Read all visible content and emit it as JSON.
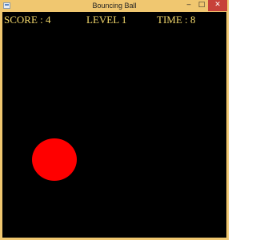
{
  "window": {
    "title": "Bouncing Ball",
    "controls": {
      "minimize": "‒",
      "maximize": "□",
      "close": "✕"
    }
  },
  "hud": {
    "score": "SCORE : 4",
    "level": "LEVEL 1",
    "time": "TIME : 8"
  },
  "colors": {
    "frame": "#f0c770",
    "background": "#000000",
    "hud_text": "#f3d86b",
    "ball": "#ff0000"
  },
  "ball": {
    "shape": "circle",
    "color": "#ff0000"
  }
}
